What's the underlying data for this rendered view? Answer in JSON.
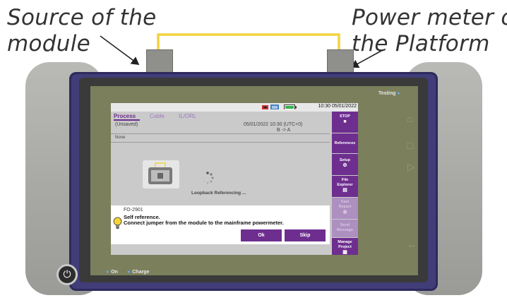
{
  "annotations": {
    "left": [
      "Source of the",
      "module"
    ],
    "right": [
      "Power meter of",
      "the Platform"
    ]
  },
  "device": {
    "testing_label": "Testing",
    "on_label": "On",
    "charge_label": "Charge"
  },
  "status_bar": {
    "time": "10:30",
    "date": "05/01/2022"
  },
  "tabs": [
    {
      "label": "Process",
      "active": true
    },
    {
      "label": "Cable",
      "active": false
    },
    {
      "label": "IL/ORL",
      "active": false
    }
  ],
  "info": {
    "file": "(Unsaved)",
    "datetime": "05/01/2022 10:30 (UTC+0)",
    "direction": "B -> A",
    "none_label": "None"
  },
  "main": {
    "loopback_text": "Loopback Referencing ..."
  },
  "side_buttons": [
    {
      "label": "STOP",
      "icon": "stop-icon",
      "enabled": true
    },
    {
      "label": "References",
      "icon": "",
      "enabled": true
    },
    {
      "label": "Setup",
      "icon": "gear-icon",
      "enabled": true
    },
    {
      "label": "File Explorer",
      "icon": "folder-icon",
      "enabled": true
    },
    {
      "label": "Fast Report",
      "icon": "report-icon",
      "enabled": false
    },
    {
      "label": "Send Message",
      "icon": "",
      "enabled": false
    },
    {
      "label": "Manage Project",
      "icon": "project-icon",
      "enabled": true
    }
  ],
  "dialog": {
    "code": "FO-2901",
    "title": "Self reference.",
    "message": "Connect jumper from the module to the mainframe powermeter.",
    "ok_label": "Ok",
    "skip_label": "Skip"
  },
  "colors": {
    "accent": "#6e2e8f",
    "cable": "#f2d33c",
    "frame": "#413d78"
  }
}
